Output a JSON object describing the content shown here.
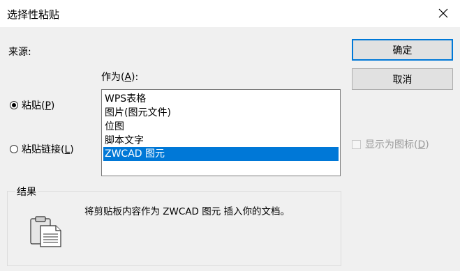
{
  "window": {
    "title": "选择性粘贴"
  },
  "source": {
    "label": "来源:"
  },
  "as": {
    "label_prefix": "作为(",
    "mnemonic": "A",
    "label_suffix": "):"
  },
  "radios": [
    {
      "label_prefix": "粘贴(",
      "mnemonic": "P",
      "label_suffix": ")",
      "checked": true
    },
    {
      "label_prefix": "粘贴链接(",
      "mnemonic": "L",
      "label_suffix": ")",
      "checked": false
    }
  ],
  "list": {
    "items": [
      "WPS表格",
      "图片(图元文件)",
      "位图",
      "脚本文字",
      "ZWCAD 图元"
    ],
    "selected_index": 4
  },
  "buttons": {
    "ok": "确定",
    "cancel": "取消"
  },
  "display_as_icon": {
    "label_prefix": "显示为图标(",
    "mnemonic": "D",
    "label_suffix": ")",
    "checked": false,
    "enabled": false
  },
  "result": {
    "title": "结果",
    "text": "将剪贴板内容作为 ZWCAD 图元 插入你的文档。",
    "icon": "clipboard-paste-icon"
  },
  "colors": {
    "selection": "#0078d7",
    "default_button_border": "#0078d7"
  }
}
